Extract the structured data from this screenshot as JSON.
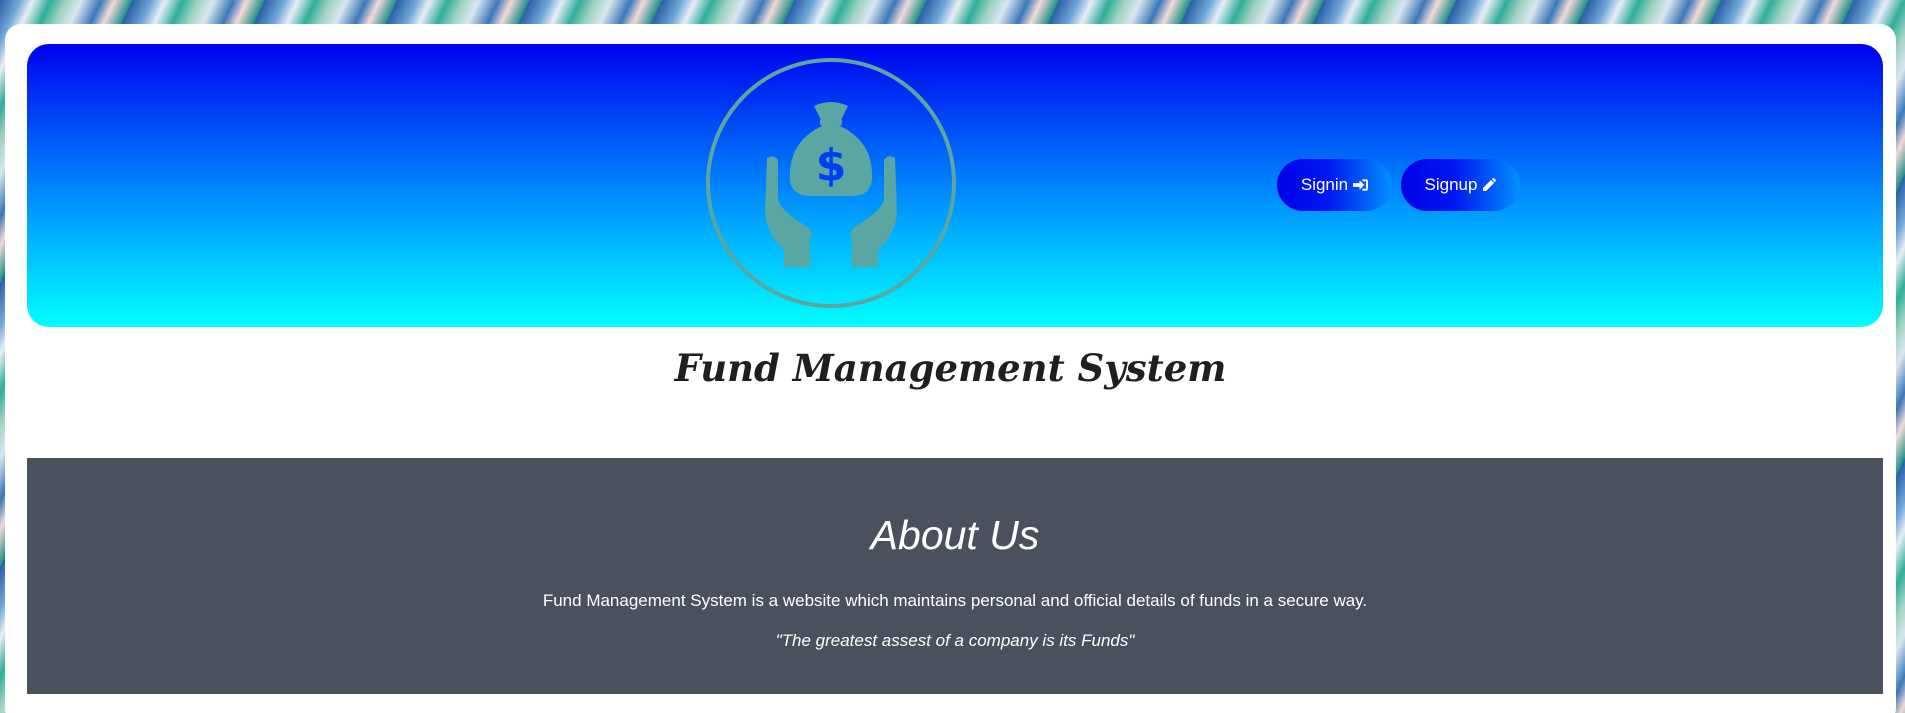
{
  "header": {
    "logo_icon": "hands-money-bag-icon",
    "logo_color": "#5aa6a2",
    "gradient_top": "#0000f0",
    "gradient_bottom": "#00ffff"
  },
  "auth": {
    "signin_label": "Signin",
    "signin_icon": "sign-in-icon",
    "signup_label": "Signup",
    "signup_icon": "pencil-icon"
  },
  "title": "Fund Management System",
  "about": {
    "heading": "About Us",
    "description": "Fund Management System is a website which maintains personal and official details of funds in a secure way.",
    "quote": "\"The greatest assest of a company is its Funds\"",
    "background": "#4a505e"
  }
}
